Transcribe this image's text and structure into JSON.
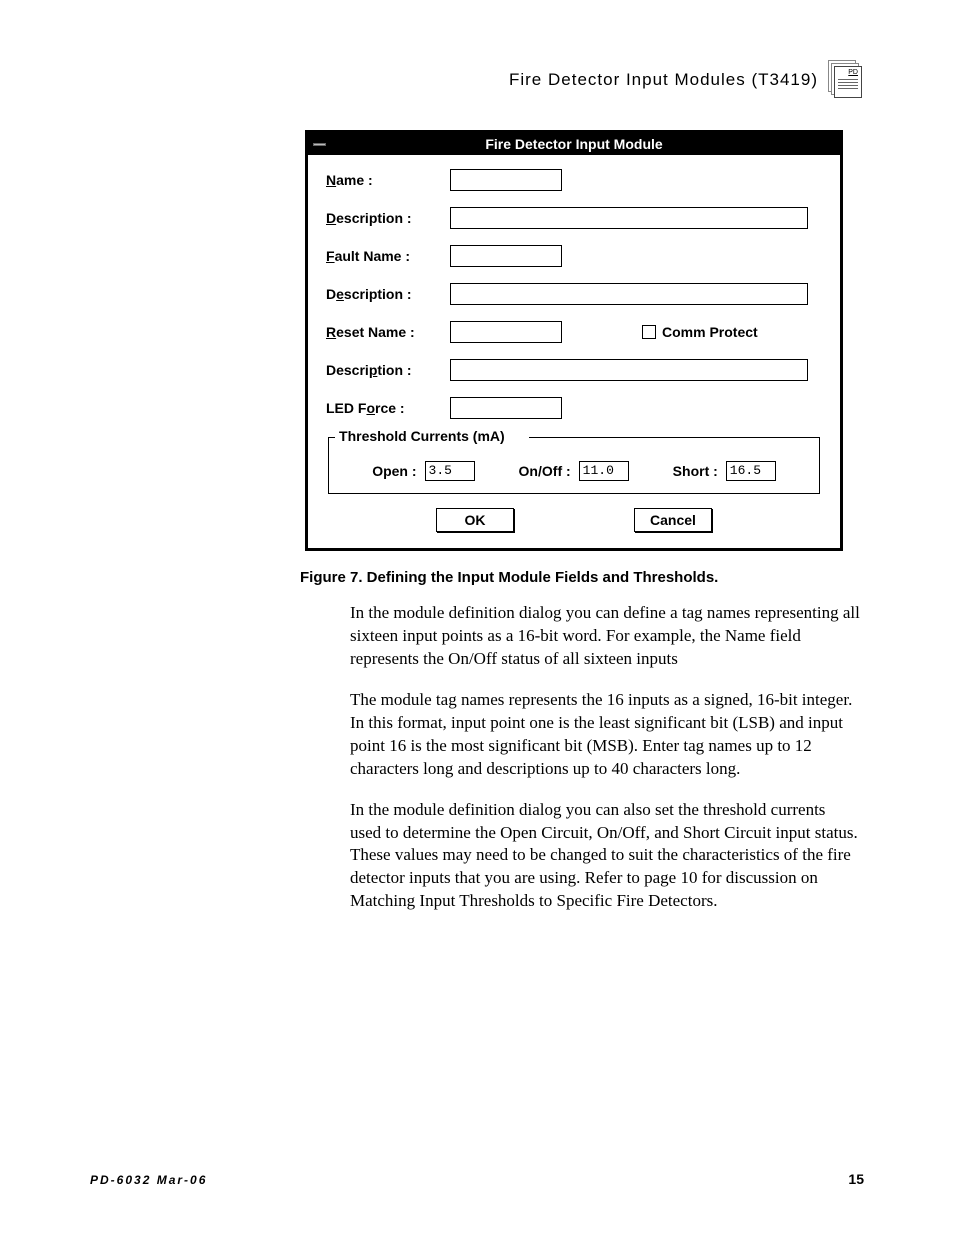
{
  "header": {
    "title": "Fire  Detector  Input  Modules (T3419)",
    "icon_label": "PD"
  },
  "dialog": {
    "title": "Fire Detector Input Module",
    "labels": {
      "name_pre": "N",
      "name_rest": "ame :",
      "desc1_pre": "D",
      "desc1_rest": "escription :",
      "fault_pre": "F",
      "fault_rest": "ault Name :",
      "desc2_pre_a": "D",
      "desc2_u": "e",
      "desc2_rest": "scription :",
      "reset_pre": "R",
      "reset_rest": "eset Name :",
      "comm_pre": "C",
      "comm_rest": "omm Protect",
      "desc3_pre": "Descri",
      "desc3_u": "p",
      "desc3_rest": "tion :",
      "led_pre": "LED F",
      "led_u": "o",
      "led_rest": "rce :"
    },
    "group": {
      "legend_pre": "T",
      "legend_rest": "hreshold Currents (mA)",
      "open_pre": "O",
      "open_rest": "pen :",
      "open_val": "3.5",
      "onoff_pre": "On/Of",
      "onoff_u": "f",
      "onoff_rest": " :",
      "onoff_val": "11.0",
      "short_pre": "S",
      "short_u": "h",
      "short_rest": "ort :",
      "short_val": "16.5"
    },
    "buttons": {
      "ok": "OK",
      "cancel": "Cancel"
    }
  },
  "caption": "Figure 7.  Defining the Input Module Fields and Thresholds.",
  "paragraphs": {
    "p1": "In the module definition dialog you can define a tag names representing all sixteen input points as a 16-bit word.  For example, the Name field represents the On/Off status of all sixteen inputs",
    "p2": "The module tag names represents the 16 inputs as a signed, 16-bit integer.  In this format, input point one is the least significant bit (LSB) and input point 16 is the most significant bit (MSB).  Enter tag names up to 12 characters long and descriptions up to 40 characters long.",
    "p3": "In the module definition dialog you can also set the threshold currents used to determine the Open Circuit, On/Off, and Short Circuit input status.  These values may need to be changed to suit the characteristics of the fire detector inputs that you are using.  Refer to page 10 for discussion on Matching Input Thresholds to Specific Fire Detectors."
  },
  "footer": {
    "docid": "PD-6032  Mar-06",
    "pageno": "15"
  }
}
